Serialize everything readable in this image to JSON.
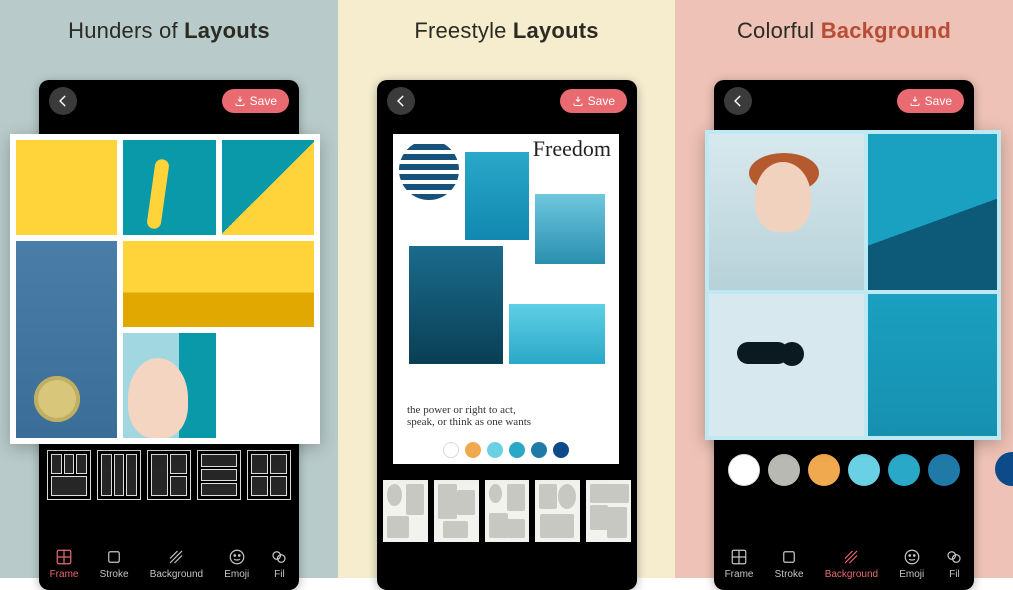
{
  "panels": [
    {
      "title_a": "Hunders of ",
      "title_b": "Layouts",
      "save": "Save",
      "nav": [
        "Frame",
        "Stroke",
        "Background",
        "Emoji",
        "Fil"
      ],
      "active": 0
    },
    {
      "title_a": "Freestyle ",
      "title_b": "Layouts",
      "save": "Save",
      "fs_title": "Freedom",
      "fs_sub": "the power or right to act,\nspeak, or think as one wants",
      "swatches": [
        "#ffffff",
        "#f0a94e",
        "#6ad1e4",
        "#2aa8c8",
        "#1f7aa8",
        "#0c4a8a"
      ]
    },
    {
      "title_a": "Colorful ",
      "title_b": "Background",
      "save": "Save",
      "colors": [
        "#ffffff",
        "#b9b9b4",
        "#f0a94e",
        "#6ad1e4",
        "#2aa8c8",
        "#1f7aa8"
      ],
      "overflow_color": "#0c4a8a",
      "nav": [
        "Frame",
        "Stroke",
        "Background",
        "Emoji",
        "Fil"
      ],
      "active": 2
    }
  ]
}
